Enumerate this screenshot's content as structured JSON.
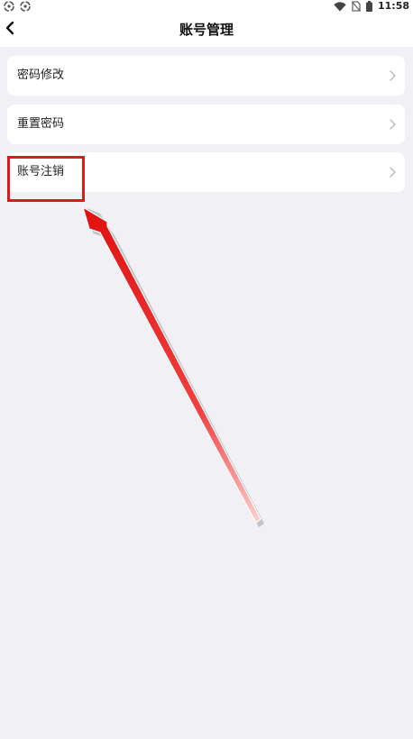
{
  "status_bar": {
    "left_icons": [
      "sync-icon",
      "sync-icon"
    ],
    "right_icons": [
      "wifi-icon",
      "no-sim-icon",
      "battery-icon"
    ],
    "time": "11:58"
  },
  "header": {
    "back_icon": "chevron-left-icon",
    "title": "账号管理"
  },
  "menu": {
    "items": [
      {
        "label": "密码修改",
        "icon": "chevron-right-icon"
      },
      {
        "label": "重置密码",
        "icon": "chevron-right-icon"
      },
      {
        "label": "账号注销",
        "icon": "chevron-right-icon"
      }
    ]
  },
  "annotation": {
    "color": "#e01818"
  },
  "colors": {
    "background": "#f0f0f5",
    "card": "#ffffff",
    "text": "#222222",
    "chevron": "#b8b8be"
  }
}
